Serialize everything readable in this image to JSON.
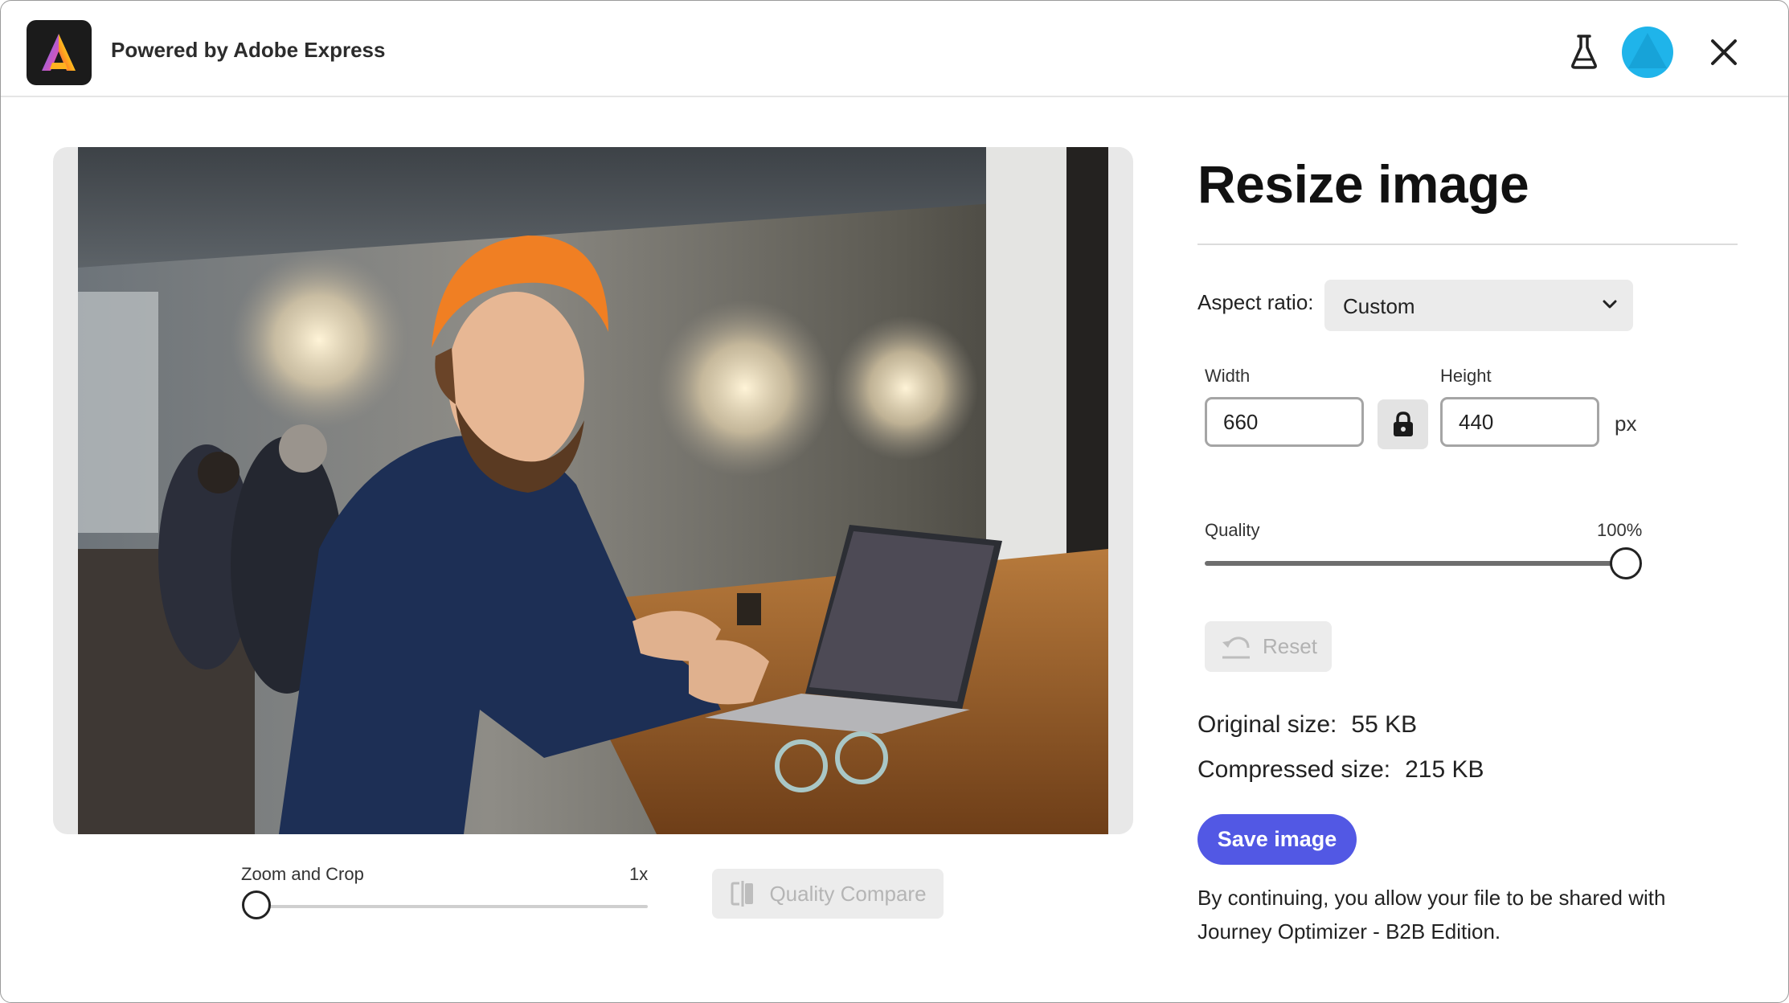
{
  "header": {
    "brand": "Powered by Adobe Express"
  },
  "preview": {
    "image_description": "photo"
  },
  "zoom": {
    "label": "Zoom and Crop",
    "value": "1x",
    "level": 0
  },
  "quality_compare": {
    "label": "Quality Compare"
  },
  "panel": {
    "title": "Resize image",
    "aspect_label": "Aspect ratio:",
    "aspect_value": "Custom",
    "width_label": "Width",
    "width_value": "660",
    "height_label": "Height",
    "height_value": "440",
    "unit": "px",
    "quality_label": "Quality",
    "quality_value": "100%",
    "quality_level": 1.0,
    "reset_label": "Reset",
    "original_size_label": "Original size:",
    "original_size_value": "55 KB",
    "compressed_size_label": "Compressed size:",
    "compressed_size_value": "215 KB",
    "save_label": "Save image",
    "consent_text": "By continuing, you allow your file to be shared with Journey Optimizer - B2B Edition."
  },
  "colors": {
    "accent": "#5258e4",
    "avatar": "#1fb4ea"
  }
}
